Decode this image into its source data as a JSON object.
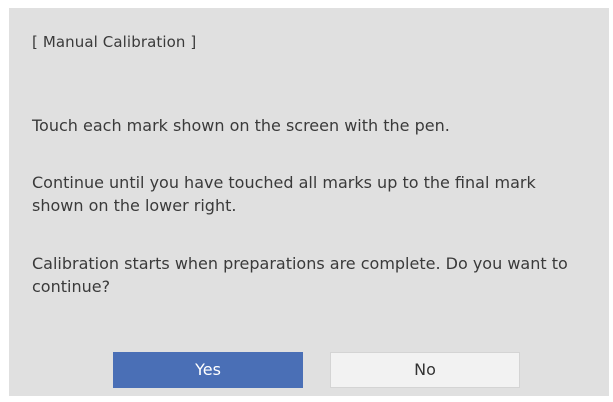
{
  "dialog": {
    "title": "[ Manual Calibration ]",
    "paragraphs": [
      "Touch each mark shown on the screen with the pen.",
      "Continue until you have touched all marks up to the final mark shown on the lower right.",
      "Calibration starts when preparations are complete. Do you want to continue?"
    ],
    "buttons": {
      "yes_label": "Yes",
      "no_label": "No"
    }
  },
  "colors": {
    "dialog_background": "#e0e0e0",
    "primary_button": "#4a6fb6",
    "secondary_button": "#f2f2f2",
    "text": "#3a3a3a"
  }
}
